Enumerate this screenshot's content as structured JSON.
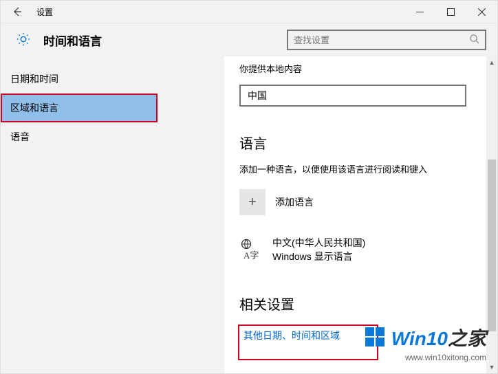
{
  "titlebar": {
    "title": "设置"
  },
  "header": {
    "heading": "时间和语言",
    "search_placeholder": "查找设置"
  },
  "sidebar": {
    "items": [
      {
        "label": "日期和时间"
      },
      {
        "label": "区域和语言"
      },
      {
        "label": "语音"
      }
    ]
  },
  "main": {
    "top_text": "你提供本地内容",
    "country_value": "中国",
    "language_heading": "语言",
    "language_desc": "添加一种语言，以便使用该语言进行阅读和键入",
    "add_language_label": "添加语言",
    "installed_lang_line1": "中文(中华人民共和国)",
    "installed_lang_line2": "Windows 显示语言",
    "related_heading": "相关设置",
    "related_link": "其他日期、时间和区域"
  },
  "watermark": {
    "brand_prefix": "Win10",
    "brand_suffix": "之家",
    "url": "www.win10xitong.com"
  }
}
